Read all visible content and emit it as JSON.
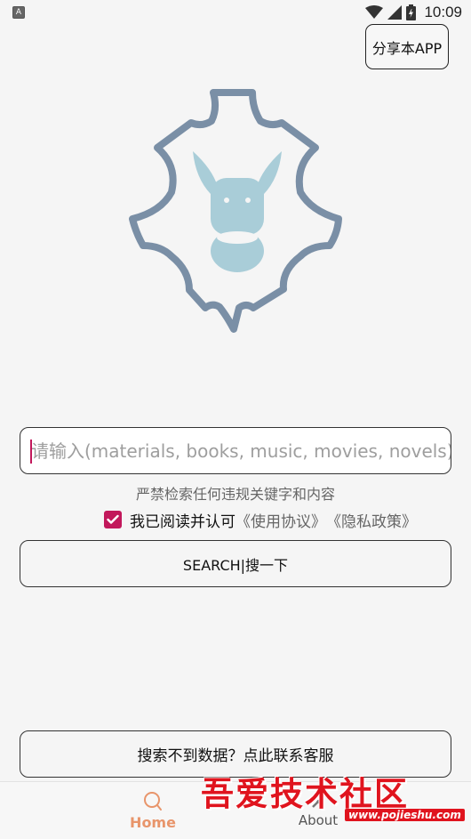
{
  "status_bar": {
    "app_icon": "A",
    "time": "10:09"
  },
  "share_button": {
    "label": "分享本APP"
  },
  "logo": {
    "icon": "donkey-leather-logo"
  },
  "search": {
    "placeholder": "请输入(materials, books, music, movies, novels)",
    "value": ""
  },
  "warning": "严禁检索任何违规关键字和内容",
  "agreement": {
    "checked": true,
    "text": "我已阅读并认可",
    "terms": "《使用协议》",
    "privacy": "《隐私政策》"
  },
  "search_button": {
    "label": "SEARCH|搜一下"
  },
  "contact_button": {
    "label": "搜索不到数据？点此联系客服"
  },
  "bottom_nav": {
    "items": [
      {
        "label": "Home",
        "icon": "search-icon",
        "active": true
      },
      {
        "label": "About",
        "icon": "close-icon",
        "active": false
      }
    ]
  },
  "watermark": {
    "title": "吾爱技术社区",
    "url": "www.pojieshu.com"
  },
  "colors": {
    "accent": "#c2185b",
    "nav_active": "#e8956b",
    "logo_outline": "#7a8fa6",
    "logo_donkey": "#a9cdd8"
  }
}
